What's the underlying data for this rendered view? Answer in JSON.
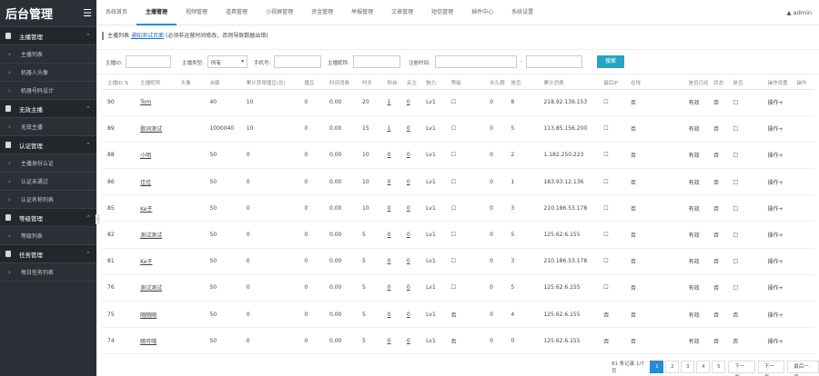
{
  "logo": {
    "title": "后台管理",
    "menu_icon": "hamburger-icon"
  },
  "sidebar": {
    "groups": [
      {
        "label": "主播管理",
        "items": [
          "主播列表",
          "机器人头像",
          "机器号码设计"
        ]
      },
      {
        "label": "无效主播",
        "items": [
          "无效主播"
        ]
      },
      {
        "label": "认证管理",
        "items": [
          "主播身份认证",
          "认证未通过",
          "认证名称列表"
        ]
      },
      {
        "label": "等级管理",
        "items": [
          "等级列表"
        ]
      },
      {
        "label": "任务管理",
        "items": [
          "每日任务列表"
        ]
      }
    ]
  },
  "tabs": [
    "系统首页",
    "主播管理",
    "视频管理",
    "道具管理",
    "小视屏管理",
    "资金管理",
    "举报管理",
    "文章管理",
    "短信管理",
    "插件中心",
    "系统设置"
  ],
  "active_tab": 1,
  "user": {
    "name": "admin",
    "icon": "triangle-icon"
  },
  "breadcrumb": {
    "prefix": "主播列表",
    "link": "通知测试页面",
    "note": "(必须非运营时间修改，否则导致数据出错)"
  },
  "filter": {
    "id_label": "主播ID:",
    "type_label": "主播类型:",
    "type_value": "所有",
    "phone_label": "手机号:",
    "nick_label": "主播昵称:",
    "time_label": "注册时间:",
    "search_label": "搜索"
  },
  "table": {
    "headers": [
      "主播ID ⇅",
      "主播昵称",
      "头像",
      "余额",
      "累计获得播豆(总)",
      "播豆",
      "时间消费",
      "时长",
      "粉丝",
      "关注",
      "魅力",
      "等级",
      "永久靓号",
      "是否",
      "累计消费",
      "最后IP",
      "在线",
      "是否已经启动",
      "状态",
      "是否",
      "操作设置",
      "操作"
    ],
    "rows": [
      [
        "90",
        "Tom",
        "",
        "40",
        "10",
        "0",
        "0.00",
        "20",
        "1",
        "0",
        "Lv1",
        "☐",
        "0",
        "8",
        "218.92.139.153",
        "☐",
        "否",
        "有效",
        "否",
        "□",
        "操作+"
      ],
      [
        "89",
        "歌词测试",
        "",
        "1000040",
        "10",
        "0",
        "0.00",
        "15",
        "1",
        "0",
        "Lv1",
        "☐",
        "0",
        "5",
        "113.85.156.200",
        "☐",
        "否",
        "有效",
        "否",
        "□",
        "操作+"
      ],
      [
        "88",
        "小明",
        "",
        "50",
        "0",
        "0",
        "0.00",
        "10",
        "0",
        "0",
        "Lv1",
        "☐",
        "0",
        "2",
        "1.182.250.223",
        "☐",
        "否",
        "有效",
        "否",
        "□",
        "操作+"
      ],
      [
        "86",
        "佳佳",
        "",
        "50",
        "0",
        "0",
        "0.00",
        "10",
        "0",
        "0",
        "Lv1",
        "☐",
        "0",
        "1",
        "183.93.12.136",
        "☐",
        "否",
        "有效",
        "否",
        "□",
        "操作+"
      ],
      [
        "85",
        "Ke子",
        "",
        "50",
        "0",
        "0",
        "0.00",
        "10",
        "0",
        "0",
        "Lv1",
        "☐",
        "0",
        "3",
        "210.186.53.178",
        "☐",
        "否",
        "有效",
        "否",
        "□",
        "操作+"
      ],
      [
        "82",
        "测试测试",
        "",
        "50",
        "0",
        "0",
        "0.00",
        "5",
        "0",
        "0",
        "Lv1",
        "☐",
        "0",
        "5",
        "125.62.6.155",
        "☐",
        "否",
        "有效",
        "否",
        "□",
        "操作+"
      ],
      [
        "81",
        "Ke子",
        "",
        "50",
        "0",
        "0",
        "0.00",
        "5",
        "0",
        "0",
        "Lv1",
        "☐",
        "0",
        "3",
        "210.186.53.178",
        "☐",
        "否",
        "有效",
        "否",
        "□",
        "操作+"
      ],
      [
        "76",
        "测试测试",
        "",
        "50",
        "0",
        "0",
        "0.00",
        "5",
        "0",
        "0",
        "Lv1",
        "☐",
        "0",
        "5",
        "125.62.6.155",
        "☐",
        "否",
        "有效",
        "否",
        "□",
        "操作+"
      ],
      [
        "75",
        "随随随",
        "",
        "50",
        "0",
        "0",
        "0.00",
        "5",
        "0",
        "0",
        "Lv1",
        "否",
        "0",
        "4",
        "125.62.6.155",
        "否",
        "否",
        "有效",
        "否",
        "否",
        "操作+"
      ],
      [
        "74",
        "随可哦",
        "",
        "50",
        "0",
        "0",
        "0.00",
        "5",
        "0",
        "0",
        "Lv1",
        "否",
        "0",
        "0",
        "125.62.6.155",
        "否",
        "否",
        "有效",
        "否",
        "否",
        "操作+"
      ]
    ]
  },
  "pager": {
    "summary": "81 条记录 1/7 页",
    "pages": [
      "1",
      "2",
      "3",
      "4",
      "5"
    ],
    "next": "下一页",
    "last": "下一页",
    "end": "最后一页"
  },
  "colors": {
    "sidebar": "#2b3036",
    "accent": "#2b8ad6",
    "search": "#22a6c6",
    "green": "#2aa34a"
  }
}
